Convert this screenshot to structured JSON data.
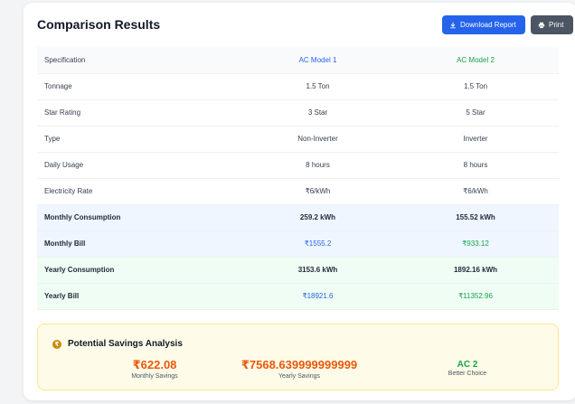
{
  "header": {
    "title": "Comparison Results",
    "download_label": "Download Report",
    "print_label": "Print"
  },
  "table": {
    "columns": [
      "Specification",
      "AC Model 1",
      "AC Model 2"
    ],
    "rows": [
      [
        "Tonnage",
        "1.5 Ton",
        "1.5 Ton"
      ],
      [
        "Star Rating",
        "3 Star",
        "5 Star"
      ],
      [
        "Type",
        "Non-Inverter",
        "Inverter"
      ],
      [
        "Daily Usage",
        "8 hours",
        "8 hours"
      ],
      [
        "Electricity Rate",
        "₹6/kWh",
        "₹6/kWh"
      ],
      [
        "Monthly Consumption",
        "259.2 kWh",
        "155.52 kWh"
      ],
      [
        "Monthly Bill",
        "₹1555.2",
        "₹933.12"
      ],
      [
        "Yearly Consumption",
        "3153.6 kWh",
        "1892.16 kWh"
      ],
      [
        "Yearly Bill",
        "₹18921.6",
        "₹11352.96"
      ]
    ]
  },
  "savings": {
    "title": "Potential Savings Analysis",
    "monthly_value": "₹622.08",
    "monthly_label": "Monthly Savings",
    "yearly_value": "₹7568.639999999999",
    "yearly_label": "Yearly Savings",
    "better_value": "AC 2",
    "better_label": "Better Choice"
  },
  "colors": {
    "primary": "#2563eb",
    "secondary": "#4b5563",
    "model2": "#16a34a",
    "savings": "#ea580c"
  }
}
